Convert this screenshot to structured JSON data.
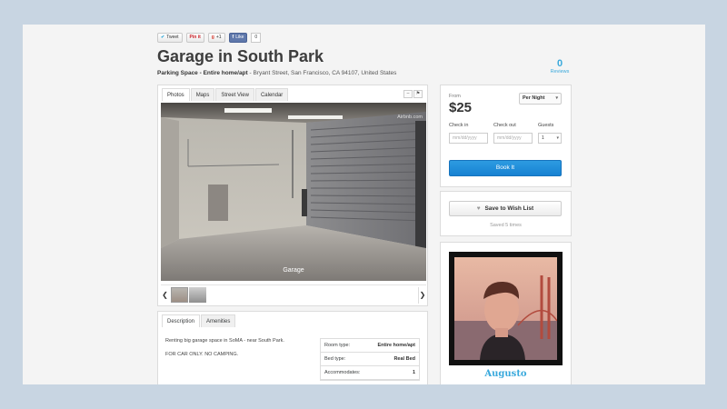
{
  "social": {
    "tweet": "Tweet",
    "pin": "Pin it",
    "gplus": "+1",
    "like": "Like",
    "like_count": "0"
  },
  "listing": {
    "title": "Garage in South Park",
    "type": "Parking Space - Entire home/apt",
    "address": "- Bryant Street, San Francisco, CA 94107, United States",
    "reviews_count": "0",
    "reviews_label": "Reviews"
  },
  "photo_tabs": [
    "Photos",
    "Maps",
    "Street View",
    "Calendar"
  ],
  "photo": {
    "watermark": "Airbnb.com",
    "caption": "Garage"
  },
  "desc_tabs": [
    "Description",
    "Amenities"
  ],
  "description": {
    "line1": "Renting big garage space in SoMA - near South Park.",
    "line2": "FOR CAR ONLY. NO CAMPING."
  },
  "specs": [
    {
      "label": "Room type:",
      "value": "Entire home/apt"
    },
    {
      "label": "Bed type:",
      "value": "Real Bed"
    },
    {
      "label": "Accommodates:",
      "value": "1"
    }
  ],
  "booking": {
    "from_label": "From",
    "price": "$25",
    "period": "Per Night",
    "checkin_label": "Check in",
    "checkout_label": "Check out",
    "guests_label": "Guests",
    "checkin_placeholder": "mm/dd/yyyy",
    "checkout_placeholder": "mm/dd/yyyy",
    "guests_value": "1",
    "book_label": "Book It"
  },
  "wishlist": {
    "button_label": "Save to Wish List",
    "saved_text": "Saved 5 times"
  },
  "host": {
    "name": "Augusto"
  },
  "colors": {
    "accent": "#39a9dc",
    "book_button": "#1f8fdc",
    "backdrop": "#c8d5e2"
  }
}
